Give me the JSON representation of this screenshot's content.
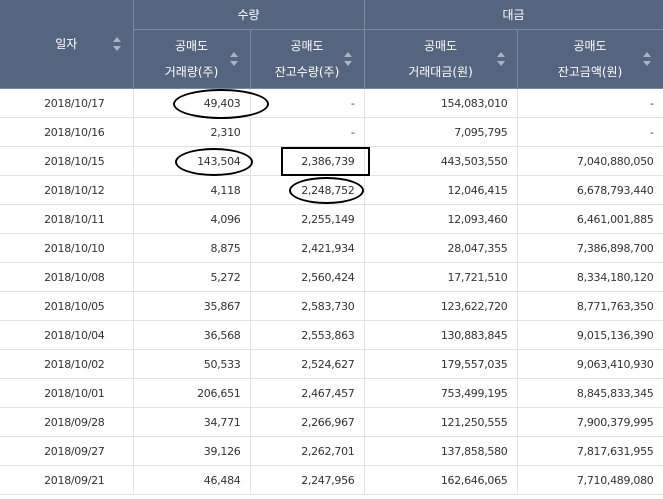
{
  "header": {
    "date": "일자",
    "quantity_group": "수량",
    "amount_group": "대금",
    "columns": [
      {
        "line1": "공매도",
        "line2": "거래량(주)"
      },
      {
        "line1": "공매도",
        "line2": "잔고수량(주)"
      },
      {
        "line1": "공매도",
        "line2": "거래대금(원)"
      },
      {
        "line1": "공매도",
        "line2": "잔고금액(원)"
      }
    ]
  },
  "rows": [
    {
      "date": "2018/10/17",
      "c1": "49,403",
      "c2": "-",
      "c3": "154,083,010",
      "c4": "-"
    },
    {
      "date": "2018/10/16",
      "c1": "2,310",
      "c2": "-",
      "c3": "7,095,795",
      "c4": "-"
    },
    {
      "date": "2018/10/15",
      "c1": "143,504",
      "c2": "2,386,739",
      "c3": "443,503,550",
      "c4": "7,040,880,050"
    },
    {
      "date": "2018/10/12",
      "c1": "4,118",
      "c2": "2,248,752",
      "c3": "12,046,415",
      "c4": "6,678,793,440"
    },
    {
      "date": "2018/10/11",
      "c1": "4,096",
      "c2": "2,255,149",
      "c3": "12,093,460",
      "c4": "6,461,001,885"
    },
    {
      "date": "2018/10/10",
      "c1": "8,875",
      "c2": "2,421,934",
      "c3": "28,047,355",
      "c4": "7,386,898,700"
    },
    {
      "date": "2018/10/08",
      "c1": "5,272",
      "c2": "2,560,424",
      "c3": "17,721,510",
      "c4": "8,334,180,120"
    },
    {
      "date": "2018/10/05",
      "c1": "35,867",
      "c2": "2,583,730",
      "c3": "123,622,720",
      "c4": "8,771,763,350"
    },
    {
      "date": "2018/10/04",
      "c1": "36,568",
      "c2": "2,553,863",
      "c3": "130,883,845",
      "c4": "9,015,136,390"
    },
    {
      "date": "2018/10/02",
      "c1": "50,533",
      "c2": "2,524,627",
      "c3": "179,557,035",
      "c4": "9,063,410,930"
    },
    {
      "date": "2018/10/01",
      "c1": "206,651",
      "c2": "2,467,457",
      "c3": "753,499,195",
      "c4": "8,845,833,345"
    },
    {
      "date": "2018/09/28",
      "c1": "34,771",
      "c2": "2,266,967",
      "c3": "121,250,555",
      "c4": "7,900,379,995"
    },
    {
      "date": "2018/09/27",
      "c1": "39,126",
      "c2": "2,262,701",
      "c3": "137,858,580",
      "c4": "7,817,631,955"
    },
    {
      "date": "2018/09/21",
      "c1": "46,484",
      "c2": "2,247,956",
      "c3": "162,646,065",
      "c4": "7,710,489,080"
    }
  ]
}
